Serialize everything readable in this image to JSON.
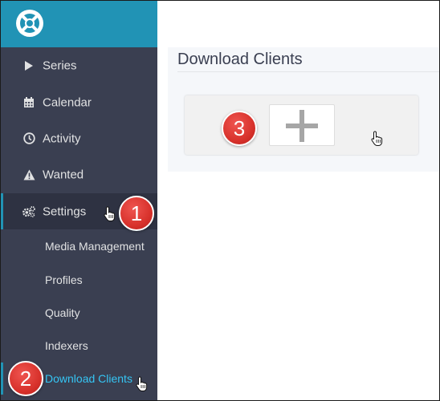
{
  "sidebar": {
    "nav": [
      {
        "label": "Series",
        "icon": "play-icon"
      },
      {
        "label": "Calendar",
        "icon": "calendar-icon"
      },
      {
        "label": "Activity",
        "icon": "clock-icon"
      },
      {
        "label": "Wanted",
        "icon": "warning-icon"
      },
      {
        "label": "Settings",
        "icon": "cogs-icon"
      }
    ],
    "settings_sub": [
      {
        "label": "Media Management"
      },
      {
        "label": "Profiles"
      },
      {
        "label": "Quality"
      },
      {
        "label": "Indexers"
      },
      {
        "label": "Download Clients"
      }
    ]
  },
  "main": {
    "title": "Download Clients",
    "add_button_icon": "plus-icon"
  },
  "annotations": {
    "step1": "1",
    "step2": "2",
    "step3": "3"
  },
  "colors": {
    "sidebar_bg": "#3a3f51",
    "logo_bar": "#2193b5",
    "active_link": "#35c5f4",
    "badge_red": "#d8322c"
  }
}
